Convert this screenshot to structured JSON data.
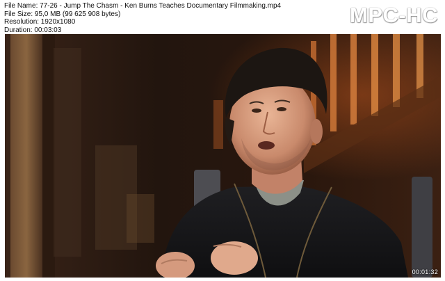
{
  "info": {
    "file_name": "File Name: 77-26 - Jump The Chasm - Ken Burns Teaches Documentary Filmmaking.mp4",
    "file_size": "File Size: 95,0 MB (99 625 908 bytes)",
    "resolution": "Resolution: 1920x1080",
    "duration": "Duration: 00:03:03"
  },
  "brand": {
    "logo_text": "MPC-HC"
  },
  "frame": {
    "timestamp": "00:01:32"
  },
  "colors": {
    "background": "#ffffff",
    "frame_dark": "#1c120c",
    "warm_glow": "#c4622a"
  }
}
